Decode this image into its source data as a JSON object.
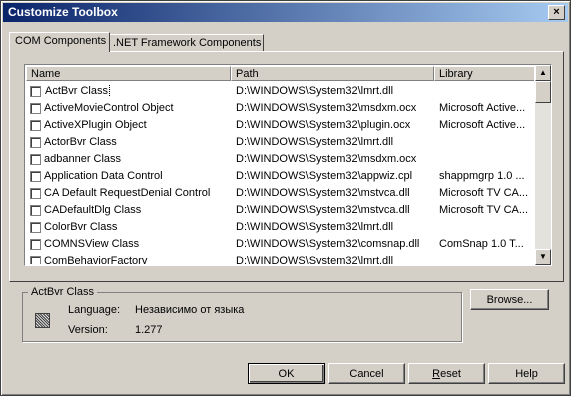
{
  "window": {
    "title": "Customize Toolbox",
    "close_glyph": "×"
  },
  "tabs": [
    {
      "label": "COM Components",
      "active": true
    },
    {
      "label": ".NET Framework Components",
      "active": false
    }
  ],
  "columns": [
    "Name",
    "Path",
    "Library"
  ],
  "rows": [
    {
      "name": "ActBvr Class",
      "path": "D:\\WINDOWS\\System32\\lmrt.dll",
      "library": "",
      "selected": true
    },
    {
      "name": "ActiveMovieControl Object",
      "path": "D:\\WINDOWS\\System32\\msdxm.ocx",
      "library": "Microsoft Active..."
    },
    {
      "name": "ActiveXPlugin Object",
      "path": "D:\\WINDOWS\\System32\\plugin.ocx",
      "library": "Microsoft Active..."
    },
    {
      "name": "ActorBvr Class",
      "path": "D:\\WINDOWS\\System32\\lmrt.dll",
      "library": ""
    },
    {
      "name": "adbanner Class",
      "path": "D:\\WINDOWS\\System32\\msdxm.ocx",
      "library": ""
    },
    {
      "name": "Application Data Control",
      "path": "D:\\WINDOWS\\System32\\appwiz.cpl",
      "library": "shappmgrp 1.0 ..."
    },
    {
      "name": "CA Default RequestDenial Control",
      "path": "D:\\WINDOWS\\System32\\mstvca.dll",
      "library": "Microsoft TV CA..."
    },
    {
      "name": "CADefaultDlg Class",
      "path": "D:\\WINDOWS\\System32\\mstvca.dll",
      "library": "Microsoft TV CA..."
    },
    {
      "name": "ColorBvr Class",
      "path": "D:\\WINDOWS\\System32\\lmrt.dll",
      "library": ""
    },
    {
      "name": "COMNSView Class",
      "path": "D:\\WINDOWS\\System32\\comsnap.dll",
      "library": "ComSnap 1.0 T..."
    },
    {
      "name": "ComBehaviorFactory",
      "path": "D:\\WINDOWS\\System32\\lmrt.dll",
      "library": ""
    }
  ],
  "scrollbar": {
    "up_glyph": "▲",
    "down_glyph": "▼"
  },
  "info": {
    "group_title": "ActBvr Class",
    "language_label": "Language:",
    "language_value": "Независимо от языка",
    "version_label": "Version:",
    "version_value": "1.277"
  },
  "buttons": {
    "browse": "Browse...",
    "ok": "OK",
    "cancel": "Cancel",
    "reset_prefix": "",
    "reset_mnemonic": "R",
    "reset_rest": "eset",
    "help": "Help"
  }
}
